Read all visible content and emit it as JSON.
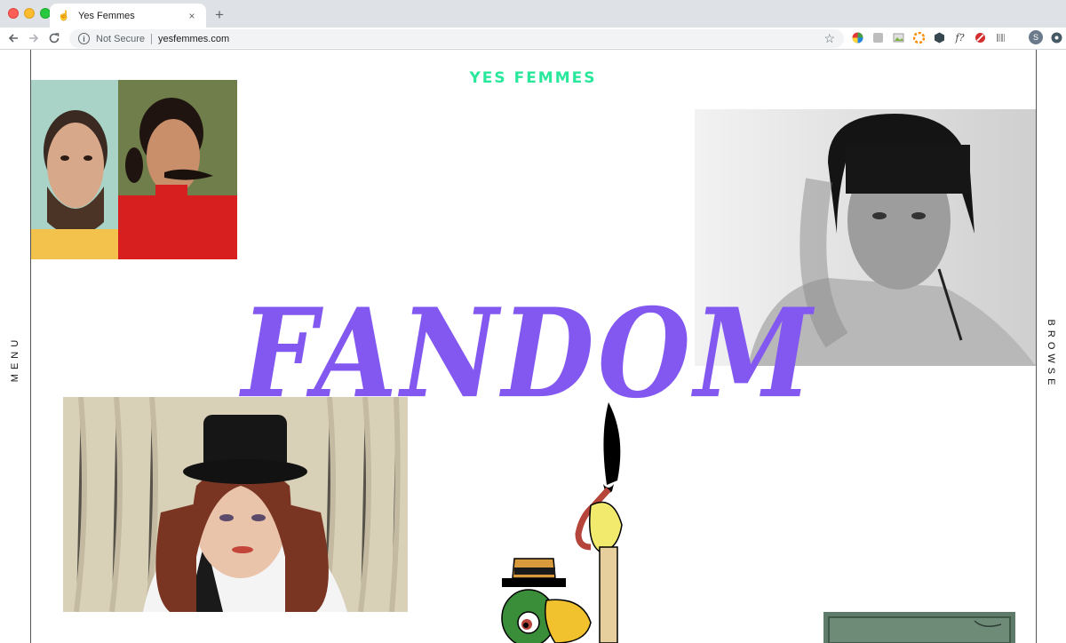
{
  "browser": {
    "tab_title": "Yes Femmes",
    "tab_close": "×",
    "new_tab": "+",
    "security_label": "Not Secure",
    "url": "yesfemmes.com",
    "profile_initial": "S",
    "icons": [
      "back-icon",
      "forward-icon",
      "reload-icon",
      "info-icon",
      "star-icon"
    ],
    "extension_icons": [
      "color-wheel-icon",
      "extension-gray-icon",
      "image-extension-icon",
      "palette-icon",
      "hexagon-icon",
      "font-icon",
      "block-icon",
      "barcode-icon",
      "profile-icon",
      "menu-circle-icon"
    ],
    "font_ext_label": "f?"
  },
  "site": {
    "logo": "YES FEMMES",
    "menu_label": "MENU",
    "browse_label": "BROWSE",
    "headline": "FANDOM",
    "accent_color": "#29e89b",
    "headline_color": "#8358f0"
  },
  "images": [
    {
      "name": "bearded-portrait-diptych"
    },
    {
      "name": "black-and-white-portrait"
    },
    {
      "name": "top-hat-portrait"
    },
    {
      "name": "cartoon-parrot-with-umbrella"
    },
    {
      "name": "green-painting-corner"
    }
  ]
}
